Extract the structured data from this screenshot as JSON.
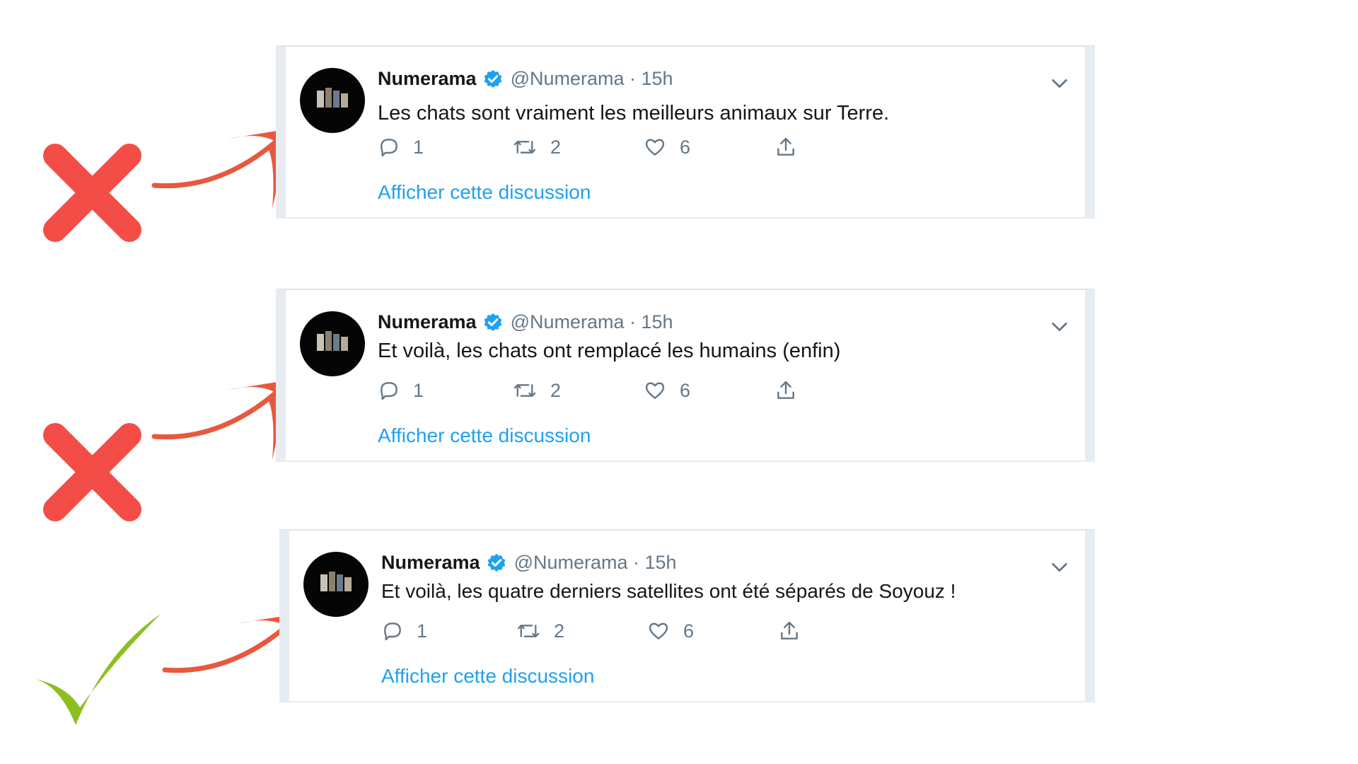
{
  "tweets": [
    {
      "name": "Numerama",
      "handle": "@Numerama",
      "time": "· 15h",
      "text": "Les chats sont vraiment les meilleurs animaux sur Terre.",
      "replies": "1",
      "retweets": "2",
      "likes": "6",
      "link": "Afficher cette discussion",
      "verdict": "cross"
    },
    {
      "name": "Numerama",
      "handle": "@Numerama",
      "time": "· 15h",
      "text": "Et voilà, les chats ont remplacé les humains (enfin)",
      "replies": "1",
      "retweets": "2",
      "likes": "6",
      "link": "Afficher cette discussion",
      "verdict": "cross"
    },
    {
      "name": "Numerama",
      "handle": "@Numerama",
      "time": "· 15h",
      "text": "Et voilà, les quatre derniers satellites ont été séparés de Soyouz !",
      "replies": "1",
      "retweets": "2",
      "likes": "6",
      "link": "Afficher cette discussion",
      "verdict": "check"
    }
  ],
  "colors": {
    "cross": "#f44d47",
    "check": "#8cbf1f",
    "arrow": "#e8583f",
    "link": "#1da1f2",
    "verified": "#1da1f2"
  },
  "icons": [
    "cross-icon",
    "check-icon",
    "arrow-icon",
    "verified-badge-icon",
    "chevron-down-icon",
    "reply-icon",
    "retweet-icon",
    "like-icon",
    "share-icon"
  ]
}
